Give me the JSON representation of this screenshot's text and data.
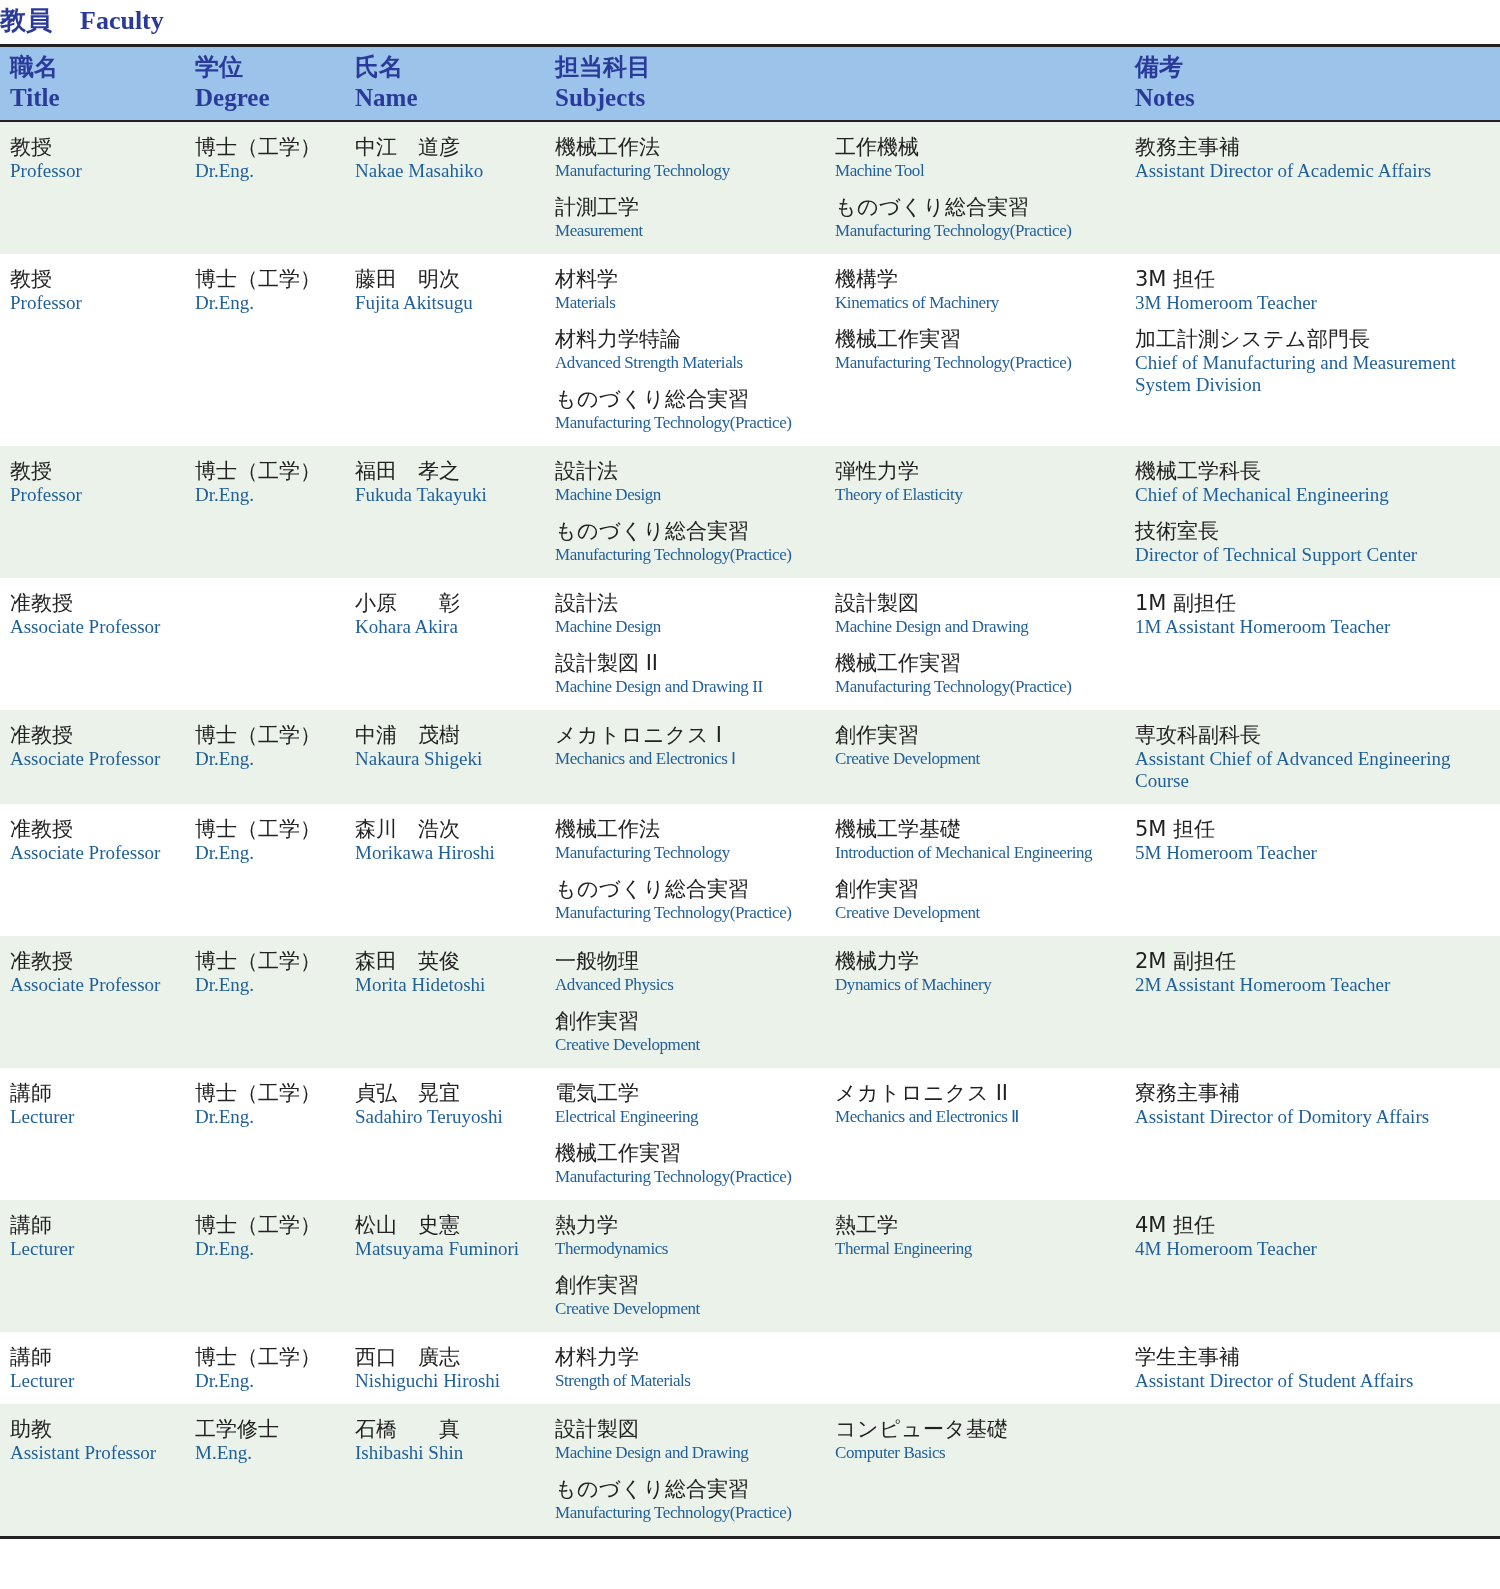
{
  "heading": {
    "ja": "教員",
    "en": "Faculty"
  },
  "columns": [
    {
      "ja": "職名",
      "en": "Title"
    },
    {
      "ja": "学位",
      "en": "Degree"
    },
    {
      "ja": "氏名",
      "en": "Name"
    },
    {
      "ja": "担当科目",
      "en": "Subjects"
    },
    {
      "ja": "備考",
      "en": "Notes"
    }
  ],
  "rows": [
    {
      "title": {
        "ja": "教授",
        "en": "Professor"
      },
      "degree": {
        "ja": "博士（工学）",
        "en": "Dr.Eng."
      },
      "name": {
        "ja": "中江　道彦",
        "en": "Nakae Masahiko"
      },
      "subjects_a": [
        {
          "ja": "機械工作法",
          "en": "Manufacturing Technology"
        },
        {
          "ja": "計測工学",
          "en": "Measurement"
        }
      ],
      "subjects_b": [
        {
          "ja": "工作機械",
          "en": "Machine Tool"
        },
        {
          "ja": "ものづくり総合実習",
          "en": "Manufacturing Technology(Practice)"
        }
      ],
      "notes": [
        {
          "ja": "教務主事補",
          "en": "Assistant Director of Academic Affairs"
        }
      ]
    },
    {
      "title": {
        "ja": "教授",
        "en": "Professor"
      },
      "degree": {
        "ja": "博士（工学）",
        "en": "Dr.Eng."
      },
      "name": {
        "ja": "藤田　明次",
        "en": "Fujita Akitsugu"
      },
      "subjects_a": [
        {
          "ja": "材料学",
          "en": "Materials"
        },
        {
          "ja": "材料力学特論",
          "en": "Advanced Strength Materials"
        },
        {
          "ja": "ものづくり総合実習",
          "en": "Manufacturing Technology(Practice)"
        }
      ],
      "subjects_b": [
        {
          "ja": "機構学",
          "en": "Kinematics of Machinery"
        },
        {
          "ja": "機械工作実習",
          "en": "Manufacturing Technology(Practice)"
        }
      ],
      "notes": [
        {
          "ja": "3M 担任",
          "en": "3M Homeroom Teacher"
        },
        {
          "ja": "加工計測システム部門長",
          "en": "Chief of Manufacturing and Measurement System Division"
        }
      ]
    },
    {
      "title": {
        "ja": "教授",
        "en": "Professor"
      },
      "degree": {
        "ja": "博士（工学）",
        "en": "Dr.Eng."
      },
      "name": {
        "ja": "福田　孝之",
        "en": "Fukuda Takayuki"
      },
      "subjects_a": [
        {
          "ja": "設計法",
          "en": "Machine Design"
        },
        {
          "ja": "ものづくり総合実習",
          "en": "Manufacturing Technology(Practice)"
        }
      ],
      "subjects_b": [
        {
          "ja": "弾性力学",
          "en": "Theory of Elasticity"
        }
      ],
      "notes": [
        {
          "ja": "機械工学科長",
          "en": "Chief of Mechanical Engineering"
        },
        {
          "ja": "技術室長",
          "en": "Director of Technical Support Center"
        }
      ]
    },
    {
      "title": {
        "ja": "准教授",
        "en": "Associate Professor"
      },
      "name": {
        "ja": "小原　　彰",
        "en": "Kohara Akira"
      },
      "subjects_a": [
        {
          "ja": "設計法",
          "en": "Machine Design"
        },
        {
          "ja": "設計製図 II",
          "en": "Machine Design and Drawing II"
        }
      ],
      "subjects_b": [
        {
          "ja": "設計製図",
          "en": "Machine Design and Drawing"
        },
        {
          "ja": "機械工作実習",
          "en": "Manufacturing Technology(Practice)"
        }
      ],
      "notes": [
        {
          "ja": "1M 副担任",
          "en": "1M Assistant Homeroom Teacher"
        }
      ]
    },
    {
      "title": {
        "ja": "准教授",
        "en": "Associate Professor"
      },
      "degree": {
        "ja": "博士（工学）",
        "en": "Dr.Eng."
      },
      "name": {
        "ja": "中浦　茂樹",
        "en": "Nakaura Shigeki"
      },
      "subjects_a": [
        {
          "ja": "メカトロニクス I",
          "en": "Mechanics and Electronics Ⅰ"
        }
      ],
      "subjects_b": [
        {
          "ja": "創作実習",
          "en": "Creative Development"
        }
      ],
      "notes": [
        {
          "ja": "専攻科副科長",
          "en": "Assistant Chief of Advanced Engineering Course"
        }
      ]
    },
    {
      "title": {
        "ja": "准教授",
        "en": "Associate Professor"
      },
      "degree": {
        "ja": "博士（工学）",
        "en": "Dr.Eng."
      },
      "name": {
        "ja": "森川　浩次",
        "en": "Morikawa Hiroshi"
      },
      "subjects_a": [
        {
          "ja": "機械工作法",
          "en": "Manufacturing Technology"
        },
        {
          "ja": "ものづくり総合実習",
          "en": "Manufacturing Technology(Practice)"
        }
      ],
      "subjects_b": [
        {
          "ja": "機械工学基礎",
          "en": "Introduction of Mechanical Engineering"
        },
        {
          "ja": "創作実習",
          "en": "Creative Development"
        }
      ],
      "notes": [
        {
          "ja": "5M 担任",
          "en": "5M Homeroom Teacher"
        }
      ]
    },
    {
      "title": {
        "ja": "准教授",
        "en": "Associate Professor"
      },
      "degree": {
        "ja": "博士（工学）",
        "en": "Dr.Eng."
      },
      "name": {
        "ja": "森田　英俊",
        "en": "Morita Hidetoshi"
      },
      "subjects_a": [
        {
          "ja": "一般物理",
          "en": "Advanced Physics"
        },
        {
          "ja": "創作実習",
          "en": "Creative Development"
        }
      ],
      "subjects_b": [
        {
          "ja": "機械力学",
          "en": "Dynamics of Machinery"
        }
      ],
      "notes": [
        {
          "ja": "2M 副担任",
          "en": "2M Assistant Homeroom Teacher"
        }
      ]
    },
    {
      "title": {
        "ja": "講師",
        "en": "Lecturer"
      },
      "degree": {
        "ja": "博士（工学）",
        "en": "Dr.Eng."
      },
      "name": {
        "ja": "貞弘　晃宜",
        "en": "Sadahiro Teruyoshi"
      },
      "subjects_a": [
        {
          "ja": "電気工学",
          "en": "Electrical Engineering"
        },
        {
          "ja": "機械工作実習",
          "en": "Manufacturing Technology(Practice)"
        }
      ],
      "subjects_b": [
        {
          "ja": "メカトロニクス II",
          "en": "Mechanics and Electronics Ⅱ"
        }
      ],
      "notes": [
        {
          "ja": "寮務主事補",
          "en": "Assistant Director of Domitory Affairs"
        }
      ]
    },
    {
      "title": {
        "ja": "講師",
        "en": "Lecturer"
      },
      "degree": {
        "ja": "博士（工学）",
        "en": "Dr.Eng."
      },
      "name": {
        "ja": "松山　史憲",
        "en": "Matsuyama Fuminori"
      },
      "subjects_a": [
        {
          "ja": "熱力学",
          "en": "Thermodynamics"
        },
        {
          "ja": "創作実習",
          "en": "Creative Development"
        }
      ],
      "subjects_b": [
        {
          "ja": "熱工学",
          "en": "Thermal Engineering"
        }
      ],
      "notes": [
        {
          "ja": "4M 担任",
          "en": "4M Homeroom Teacher"
        }
      ]
    },
    {
      "title": {
        "ja": "講師",
        "en": "Lecturer"
      },
      "degree": {
        "ja": "博士（工学）",
        "en": "Dr.Eng."
      },
      "name": {
        "ja": "西口　廣志",
        "en": "Nishiguchi Hiroshi"
      },
      "subjects_a": [
        {
          "ja": "材料力学",
          "en": "Strength of Materials"
        }
      ],
      "subjects_b": [],
      "notes": [
        {
          "ja": "学生主事補",
          "en": "Assistant Director of Student Affairs"
        }
      ]
    },
    {
      "title": {
        "ja": "助教",
        "en": "Assistant Professor"
      },
      "degree": {
        "ja": "工学修士",
        "en": "M.Eng."
      },
      "name": {
        "ja": "石橋　　真",
        "en": "Ishibashi Shin"
      },
      "subjects_a": [
        {
          "ja": "設計製図",
          "en": "Machine Design and Drawing"
        },
        {
          "ja": "ものづくり総合実習",
          "en": "Manufacturing Technology(Practice)"
        }
      ],
      "subjects_b": [
        {
          "ja": "コンピュータ基礎",
          "en": "Computer Basics"
        }
      ],
      "notes": []
    }
  ]
}
